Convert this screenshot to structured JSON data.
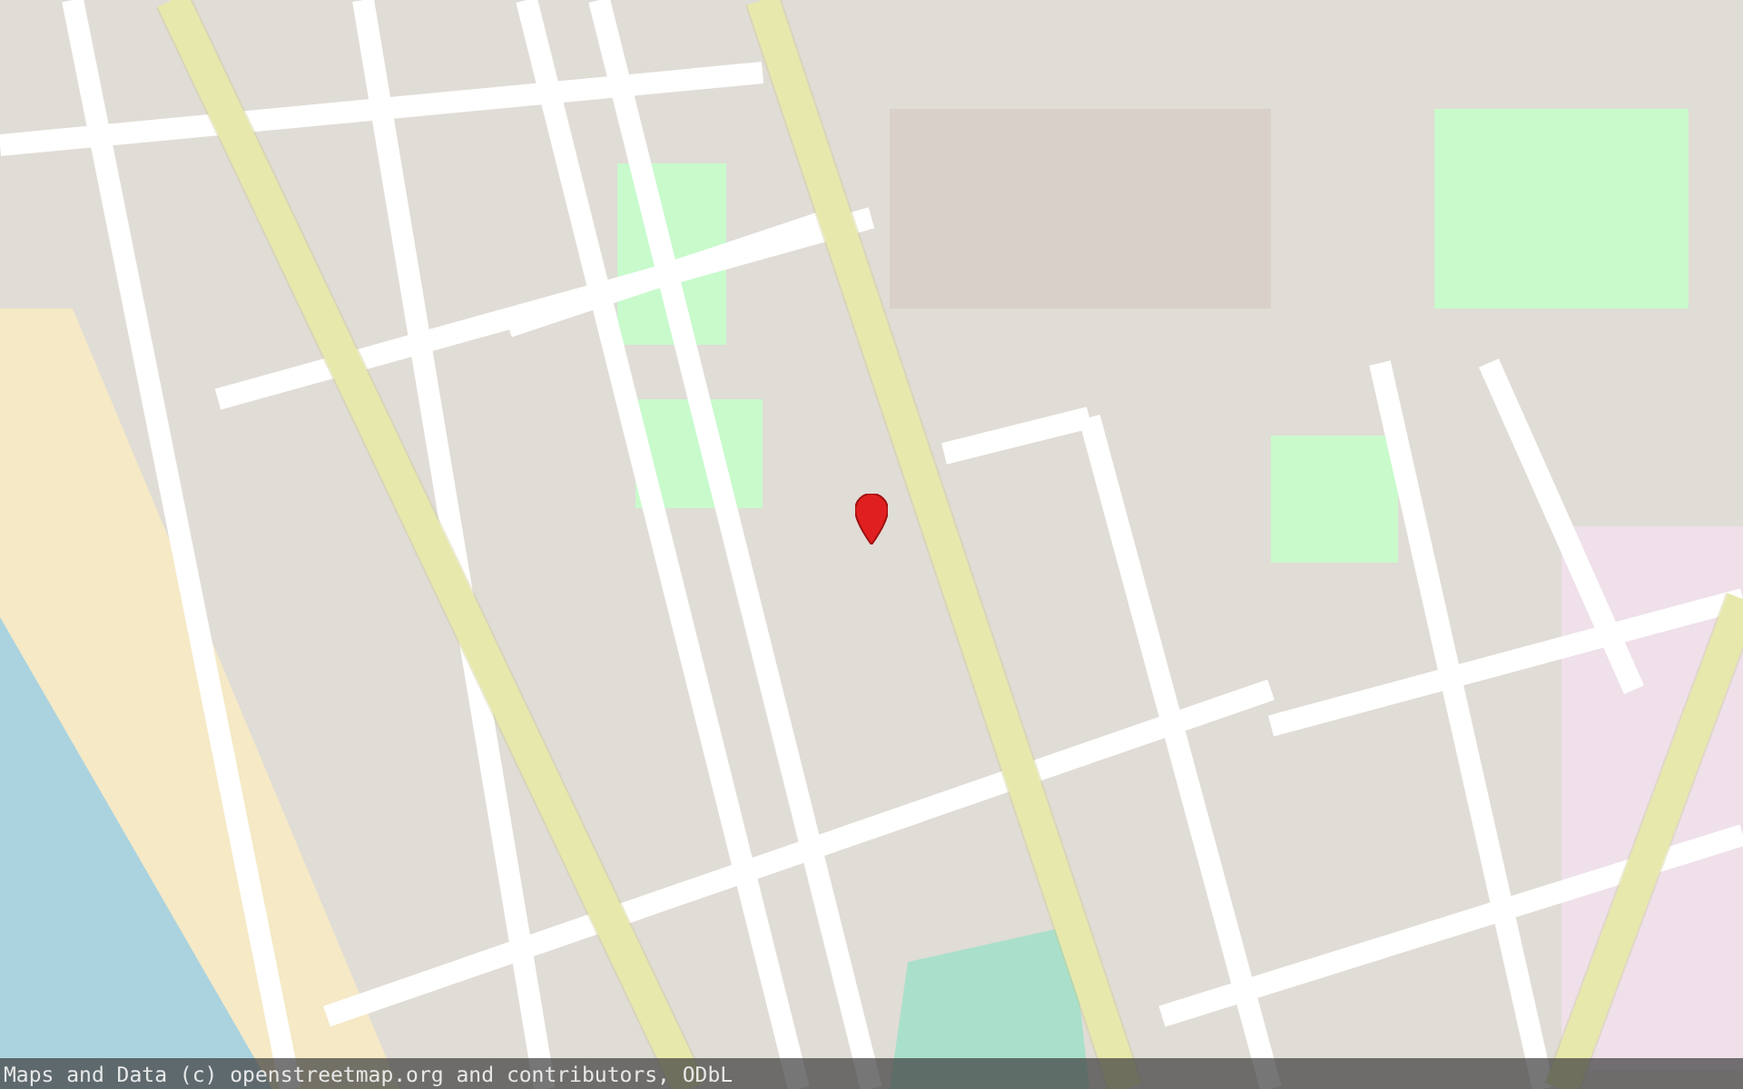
{
  "map": {
    "marker": true
  },
  "attribution": "Maps and Data (c) openstreetmap.org and contributors, ODbL"
}
